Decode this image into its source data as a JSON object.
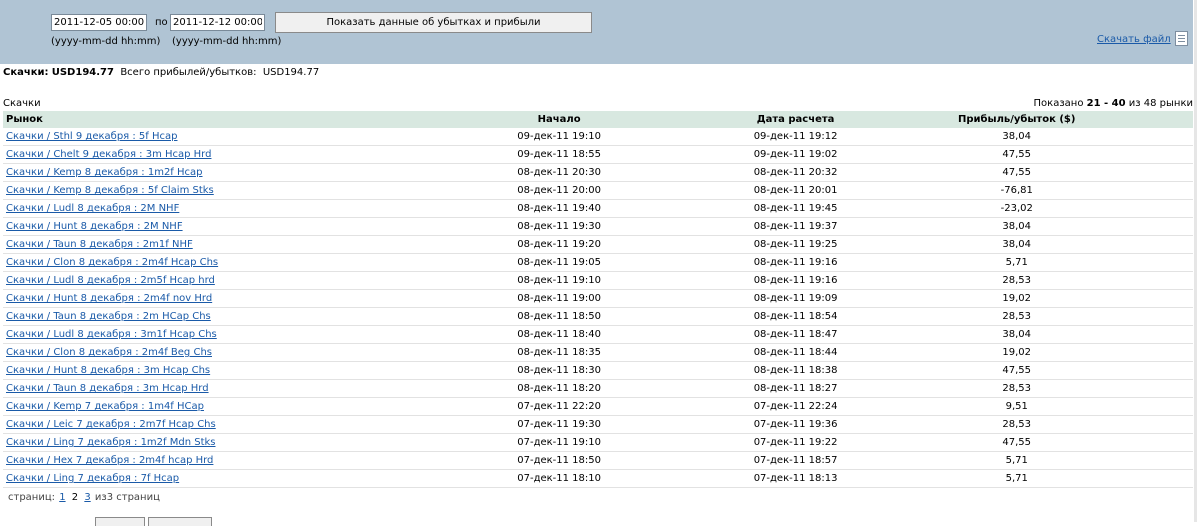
{
  "filter": {
    "from_value": "2011-12-05 00:00",
    "to_label": "по",
    "to_value": "2011-12-12 00:00",
    "from_hint": "(yyyy-mm-dd hh:mm)",
    "to_hint": "(yyyy-mm-dd hh:mm)",
    "show_button": "Показать данные об убытках и прибыли",
    "download_link": "Скачать файл"
  },
  "summary": {
    "label": "Скачки:",
    "value": "USD194.77",
    "total_label": "Всего прибылей/убытков:",
    "total_value": "USD194.77"
  },
  "section": {
    "title": "Скачки",
    "shown_prefix": "Показано",
    "shown_range": "21 - 40",
    "shown_suffix": "из 48 рынки"
  },
  "table": {
    "headers": [
      "Рынок",
      "Начало",
      "Дата расчета",
      "Прибыль/убыток ($)"
    ],
    "rows": [
      {
        "market": "Скачки / Sthl 9 декабря : 5f Hcap",
        "start": "09-дек-11 19:10",
        "settled": "09-дек-11 19:12",
        "pl": "38,04"
      },
      {
        "market": "Скачки / Chelt 9 декабря : 3m Hcap Hrd",
        "start": "09-дек-11 18:55",
        "settled": "09-дек-11 19:02",
        "pl": "47,55"
      },
      {
        "market": "Скачки / Kemp 8 декабря : 1m2f Hcap",
        "start": "08-дек-11 20:30",
        "settled": "08-дек-11 20:32",
        "pl": "47,55"
      },
      {
        "market": "Скачки / Kemp 8 декабря : 5f Claim Stks",
        "start": "08-дек-11 20:00",
        "settled": "08-дек-11 20:01",
        "pl": "-76,81"
      },
      {
        "market": "Скачки / Ludl 8 декабря : 2M NHF",
        "start": "08-дек-11 19:40",
        "settled": "08-дек-11 19:45",
        "pl": "-23,02"
      },
      {
        "market": "Скачки / Hunt 8 декабря : 2M NHF",
        "start": "08-дек-11 19:30",
        "settled": "08-дек-11 19:37",
        "pl": "38,04"
      },
      {
        "market": "Скачки / Taun 8 декабря : 2m1f NHF",
        "start": "08-дек-11 19:20",
        "settled": "08-дек-11 19:25",
        "pl": "38,04"
      },
      {
        "market": "Скачки / Clon 8 декабря : 2m4f Hcap Chs",
        "start": "08-дек-11 19:05",
        "settled": "08-дек-11 19:16",
        "pl": "5,71"
      },
      {
        "market": "Скачки / Ludl 8 декабря : 2m5f Hcap hrd",
        "start": "08-дек-11 19:10",
        "settled": "08-дек-11 19:16",
        "pl": "28,53"
      },
      {
        "market": "Скачки / Hunt 8 декабря : 2m4f nov Hrd",
        "start": "08-дек-11 19:00",
        "settled": "08-дек-11 19:09",
        "pl": "19,02"
      },
      {
        "market": "Скачки / Taun 8 декабря : 2m HCap Chs",
        "start": "08-дек-11 18:50",
        "settled": "08-дек-11 18:54",
        "pl": "28,53"
      },
      {
        "market": "Скачки / Ludl 8 декабря : 3m1f Hcap Chs",
        "start": "08-дек-11 18:40",
        "settled": "08-дек-11 18:47",
        "pl": "38,04"
      },
      {
        "market": "Скачки / Clon 8 декабря : 2m4f Beg Chs",
        "start": "08-дек-11 18:35",
        "settled": "08-дек-11 18:44",
        "pl": "19,02"
      },
      {
        "market": "Скачки / Hunt 8 декабря : 3m Hcap Chs",
        "start": "08-дек-11 18:30",
        "settled": "08-дек-11 18:38",
        "pl": "47,55"
      },
      {
        "market": "Скачки / Taun 8 декабря : 3m Hcap Hrd",
        "start": "08-дек-11 18:20",
        "settled": "08-дек-11 18:27",
        "pl": "28,53"
      },
      {
        "market": "Скачки / Kemp 7 декабря : 1m4f HCap",
        "start": "07-дек-11 22:20",
        "settled": "07-дек-11 22:24",
        "pl": "9,51"
      },
      {
        "market": "Скачки / Leic 7 декабря : 2m7f Hcap Chs",
        "start": "07-дек-11 19:30",
        "settled": "07-дек-11 19:36",
        "pl": "28,53"
      },
      {
        "market": "Скачки / Ling 7 декабря : 1m2f Mdn Stks",
        "start": "07-дек-11 19:10",
        "settled": "07-дек-11 19:22",
        "pl": "47,55"
      },
      {
        "market": "Скачки / Hex 7 декабря : 2m4f hcap Hrd",
        "start": "07-дек-11 18:50",
        "settled": "07-дек-11 18:57",
        "pl": "5,71"
      },
      {
        "market": "Скачки / Ling 7 декабря : 7f Hcap",
        "start": "07-дек-11 18:10",
        "settled": "07-дек-11 18:13",
        "pl": "5,71"
      }
    ]
  },
  "pager": {
    "label": "страниц:",
    "pages": [
      "1",
      "2",
      "3"
    ],
    "current_index": 1,
    "suffix": "из3 страниц"
  }
}
